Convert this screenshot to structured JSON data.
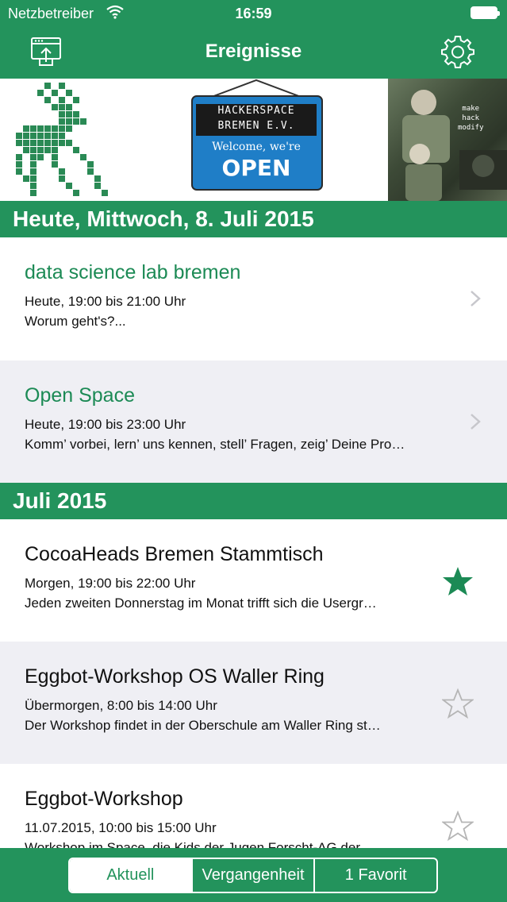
{
  "status_bar": {
    "carrier": "Netzbetreiber",
    "time": "16:59"
  },
  "nav": {
    "title": "Ereignisse",
    "left_icon": "share-icon",
    "right_icon": "gear-icon"
  },
  "banner": {
    "sign_line1": "HACKERSPACE",
    "sign_line2": "BREMEN E.V.",
    "sign_line3": "Welcome, we're",
    "sign_line4": "OPEN",
    "photo_text": "make\nhack\nmodify"
  },
  "sections": [
    {
      "header": "Heute, Mittwoch, 8. Juli 2015",
      "events": [
        {
          "title": "data science lab bremen",
          "time": "Heute, 19:00 bis 21:00 Uhr",
          "description": "Worum geht's?...",
          "accessory": "chevron-right-icon"
        },
        {
          "title": "Open Space",
          "time": "Heute, 19:00 bis 23:00 Uhr",
          "description": "Komm’ vorbei, lern’ uns kennen, stell’ Fragen, zeig’ Deine Pro…",
          "accessory": "chevron-right-icon"
        }
      ]
    },
    {
      "header": "Juli 2015",
      "events": [
        {
          "title": "CocoaHeads Bremen Stammtisch",
          "time": "Morgen, 19:00 bis 22:00 Uhr",
          "description": "Jeden zweiten Donnerstag im Monat trifft sich die Usergr…",
          "favorite": true
        },
        {
          "title": "Eggbot-Workshop OS Waller Ring",
          "time": "Übermorgen, 8:00 bis 14:00 Uhr",
          "description": "Der Workshop findet in der Oberschule am Waller Ring st…",
          "favorite": false
        },
        {
          "title": "Eggbot-Workshop",
          "time": "11.07.2015, 10:00 bis 15:00 Uhr",
          "description": "Workshop im Space, die Kids der Jugen Forscht-AG der…",
          "favorite": false
        }
      ]
    }
  ],
  "tabs": [
    {
      "label": "Aktuell",
      "selected": true
    },
    {
      "label": "Vergangenheit",
      "selected": false
    },
    {
      "label": "1 Favorit",
      "selected": false
    }
  ],
  "colors": {
    "brand_green": "#23935c",
    "title_green": "#1c8a55",
    "row_grey": "#efeff4"
  }
}
